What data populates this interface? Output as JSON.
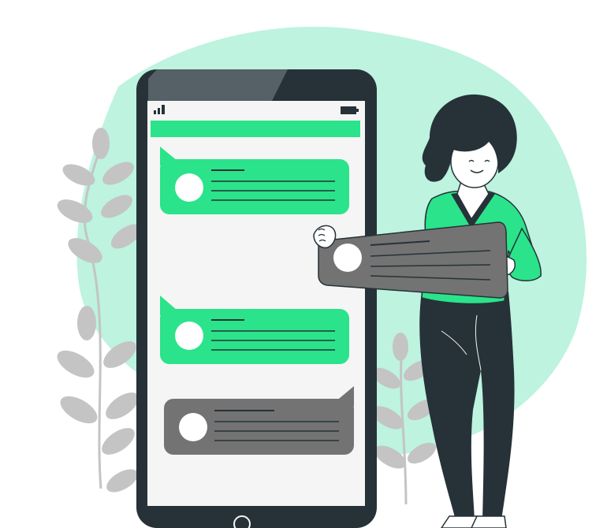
{
  "colors": {
    "background": "#ffffff",
    "blob": "#bdf3df",
    "accent_green": "#2be38a",
    "dark": "#263238",
    "gray_bubble": "#737373",
    "screen": "#f5f5f5",
    "leaf": "#c4c4c4",
    "skin": "#ffffff"
  },
  "status_bar": {
    "signal_icon": "signal-bars-icon",
    "battery_icon": "battery-icon"
  },
  "messages": [
    {
      "side": "incoming",
      "color": "accent_green",
      "avatar": "avatar-icon",
      "lines": 3
    },
    {
      "side": "incoming",
      "color": "accent_green",
      "avatar": "avatar-icon",
      "lines": 3
    },
    {
      "side": "outgoing",
      "color": "gray_bubble",
      "avatar": "avatar-icon",
      "lines": 3
    }
  ],
  "held_message": {
    "color": "gray_bubble",
    "avatar": "avatar-icon",
    "lines": 3
  },
  "home_button_icon": "home-button-icon"
}
